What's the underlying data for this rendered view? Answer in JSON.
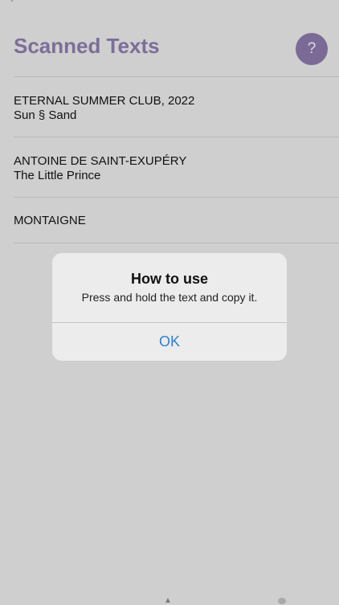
{
  "header": {
    "title": "Scanned Texts",
    "help_label": "?"
  },
  "list": [
    {
      "line1": "ETERNAL SUMMER CLUB, 2022",
      "line2": "Sun § Sand"
    },
    {
      "line1": "ANTOINE DE SAINT-EXUPÉRY",
      "line2": "The Little Prince"
    },
    {
      "line1": "MONTAIGNE"
    }
  ],
  "alert": {
    "title": "How to use",
    "message": "Press and hold the text and copy it.",
    "ok_label": "OK"
  },
  "colors": {
    "accent": "#7c6e99",
    "link": "#2f7fd0",
    "background": "#cfcfcf"
  }
}
